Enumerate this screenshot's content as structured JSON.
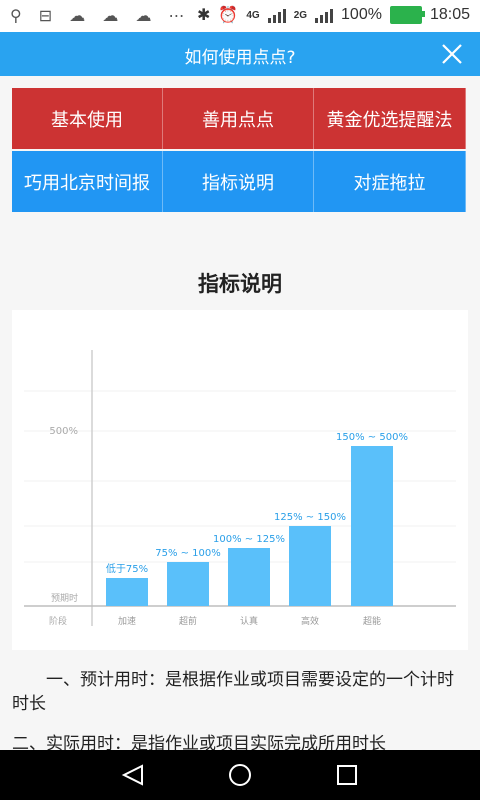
{
  "status_bar": {
    "notification_icons": "⚲ ⊟ ☁ ☁ ☁ ⋯",
    "battery_percent": "100%",
    "time": "18:05",
    "network_label_1": "4G",
    "network_label_2": "2G"
  },
  "header": {
    "title": "如何使用点点?"
  },
  "menu": {
    "items": [
      {
        "label": "基本使用",
        "color": "#cc3333"
      },
      {
        "label": "善用点点",
        "color": "#cc3333"
      },
      {
        "label": "黄金优选提醒法",
        "color": "#cc3333"
      },
      {
        "label": "巧用北京时间报",
        "color": "#2196f3"
      },
      {
        "label": "指标说明",
        "color": "#2196f3"
      },
      {
        "label": "对症拖拉",
        "color": "#2196f3"
      }
    ]
  },
  "section": {
    "title": "指标说明"
  },
  "chart_data": {
    "type": "bar",
    "categories": [
      "加速",
      "超前",
      "认真",
      "高效",
      "超能"
    ],
    "values": [
      75,
      100,
      125,
      150,
      500
    ],
    "data_labels": [
      "低于75%",
      "75% ~ 100%",
      "100% ~ 125%",
      "125% ~ 150%",
      "150% ~ 500%"
    ],
    "y_tick_label": "500%",
    "y_baseline_label": "预期时",
    "x_row_label": "阶段",
    "bar_color": "#5ac0fa",
    "label_color": "#2a9fe8"
  },
  "paragraphs": [
    "一、预计用时：是根据作业或项目需要设定的一个计时时长",
    "二、实际用时：是指作业或项目实际完成所用时长"
  ],
  "nav": {
    "back_icon": "back-icon",
    "home_icon": "home-icon",
    "recent_icon": "recent-apps-icon"
  }
}
